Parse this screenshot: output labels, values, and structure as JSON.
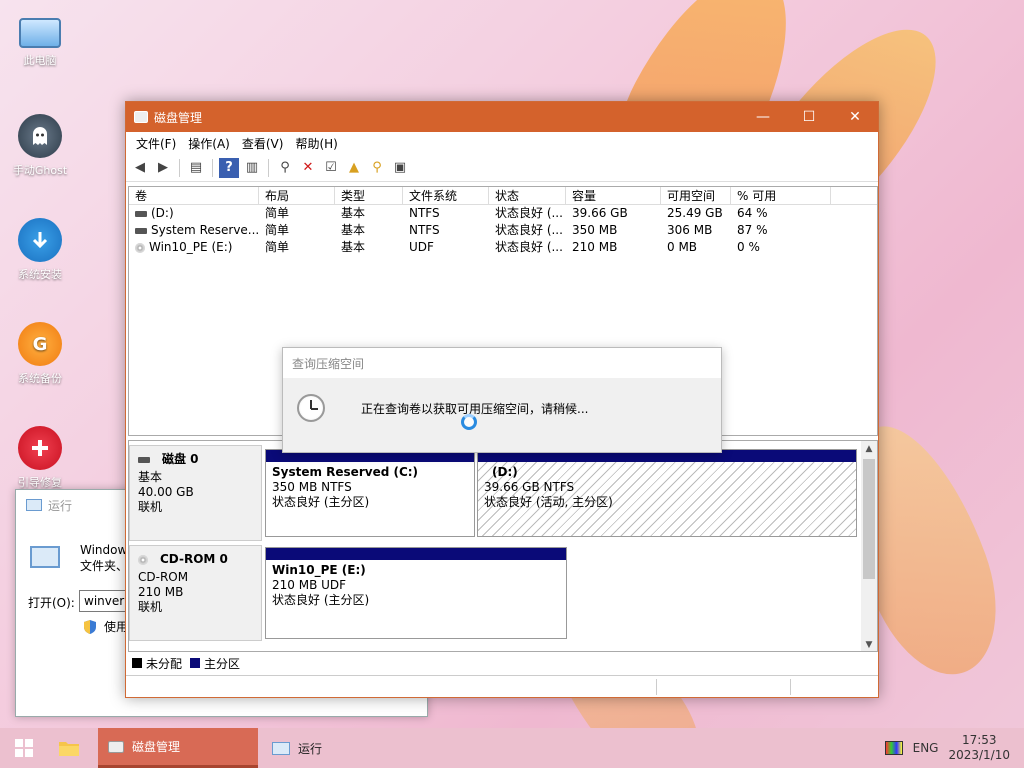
{
  "desktop": {
    "icons": [
      {
        "label": "此电脑",
        "icon": "computer-icon"
      },
      {
        "label": "手动Ghost",
        "icon": "ghost-icon"
      },
      {
        "label": "系统安装",
        "icon": "download-arrow-icon"
      },
      {
        "label": "系统备份",
        "icon": "g-logo-icon"
      },
      {
        "label": "引导修复",
        "icon": "plus-icon"
      }
    ]
  },
  "run_dialog": {
    "title": "运行",
    "desc_line1": "Window",
    "desc_line2": "文件夹、",
    "open_label": "打开(O):",
    "input_value": "winver",
    "admin_text": "使用"
  },
  "window": {
    "title": "磁盘管理",
    "menu": [
      "文件(F)",
      "操作(A)",
      "查看(V)",
      "帮助(H)"
    ],
    "columns": [
      "卷",
      "布局",
      "类型",
      "文件系统",
      "状态",
      "容量",
      "可用空间",
      "% 可用"
    ],
    "volumes": [
      {
        "name": "(D:)",
        "layout": "简单",
        "type": "基本",
        "fs": "NTFS",
        "status": "状态良好 (...",
        "capacity": "39.66 GB",
        "free": "25.49 GB",
        "pct": "64 %"
      },
      {
        "name": "System Reserve...",
        "layout": "简单",
        "type": "基本",
        "fs": "NTFS",
        "status": "状态良好 (...",
        "capacity": "350 MB",
        "free": "306 MB",
        "pct": "87 %"
      },
      {
        "name": "Win10_PE (E:)",
        "layout": "简单",
        "type": "基本",
        "fs": "UDF",
        "status": "状态良好 (...",
        "capacity": "210 MB",
        "free": "0 MB",
        "pct": "0 %"
      }
    ],
    "disks": [
      {
        "name": "磁盘 0",
        "kind": "基本",
        "size": "40.00 GB",
        "state": "联机",
        "partitions": [
          {
            "name": "System Reserved  (C:)",
            "size": "350 MB NTFS",
            "status": "状态良好 (主分区)"
          },
          {
            "name": "(D:)",
            "size": "39.66 GB NTFS",
            "status": "状态良好 (活动, 主分区)"
          }
        ]
      },
      {
        "name": "CD-ROM 0",
        "kind": "CD-ROM",
        "size": "210 MB",
        "state": "联机",
        "partitions": [
          {
            "name": "Win10_PE   (E:)",
            "size": "210 MB UDF",
            "status": "状态良好 (主分区)"
          }
        ]
      }
    ],
    "legend": [
      {
        "label": "未分配",
        "color": "#000000"
      },
      {
        "label": "主分区",
        "color": "#0a0a78"
      }
    ]
  },
  "query_dialog": {
    "title": "查询压缩空间",
    "message": "正在查询卷以获取可用压缩空间，请稍候..."
  },
  "taskbar": {
    "items": [
      "磁盘管理",
      "运行"
    ],
    "lang": "ENG",
    "time": "17:53",
    "date": "2023/1/10"
  },
  "colors": {
    "title_bar": "#d4622c",
    "partition_bar": "#0a0a78"
  }
}
